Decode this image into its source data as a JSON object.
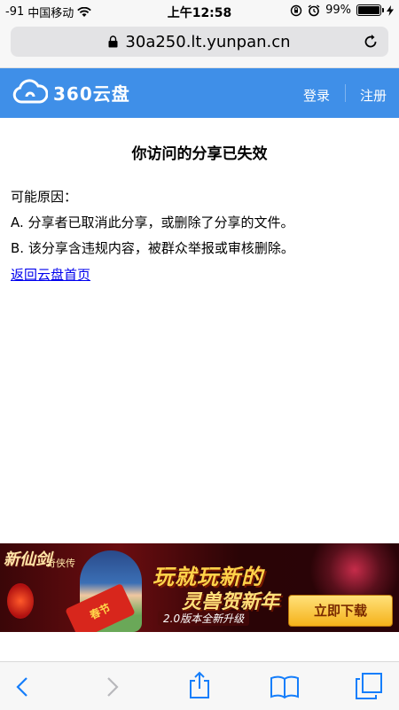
{
  "status_bar": {
    "signal": "-91",
    "carrier": "中国移动",
    "time": "上午12:58",
    "battery": "99%",
    "battery_level": 0.99
  },
  "browser": {
    "url": "30a250.lt.yunpan.cn"
  },
  "app_header": {
    "logo_text": "360云盘",
    "login": "登录",
    "register": "注册",
    "accent_color": "#3f8fe8"
  },
  "main": {
    "title": "你访问的分享已失效",
    "reason_heading": "可能原因：",
    "reasons": [
      "A. 分享者已取消此分享，或删除了分享的文件。",
      "B. 该分享含违规内容，被群众举报或审核删除。"
    ],
    "back_link": "返回云盘首页"
  },
  "banner": {
    "game_title": "新仙剑",
    "game_subtitle": "奇侠传",
    "scroll_text": "春节",
    "slogan1": "玩就玩新的",
    "slogan2": "灵兽贺新年",
    "version": "2.0版本全新升级",
    "download_button": "立即下载"
  },
  "toolbar": {
    "icons": [
      "back-icon",
      "forward-icon",
      "share-icon",
      "bookmarks-icon",
      "tabs-icon"
    ]
  }
}
